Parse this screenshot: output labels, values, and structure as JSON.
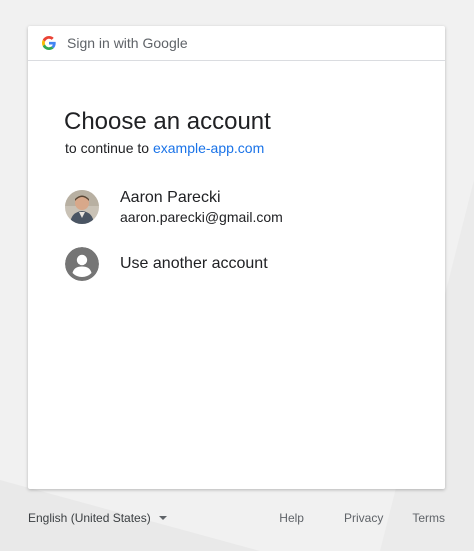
{
  "header": {
    "logo_icon": "google-g-icon",
    "title": "Sign in with Google"
  },
  "main": {
    "heading": "Choose an account",
    "subheading_prefix": "to continue to ",
    "app_link": "example-app.com",
    "accounts": [
      {
        "name": "Aaron Parecki",
        "email": "aaron.parecki@gmail.com",
        "avatar_icon": "profile-photo"
      },
      {
        "name": "Use another account",
        "avatar_icon": "generic-user-icon"
      }
    ]
  },
  "footer": {
    "language": "English (United States)",
    "help": "Help",
    "privacy": "Privacy",
    "terms": "Terms"
  },
  "colors": {
    "link": "#1a73e8",
    "text": "#202124",
    "muted": "#5f6368",
    "background": "#f1f1f1"
  }
}
